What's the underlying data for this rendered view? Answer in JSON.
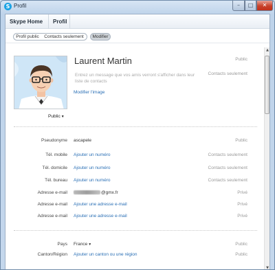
{
  "window": {
    "title": "Profil"
  },
  "tabs": [
    {
      "label": "Skype Home"
    },
    {
      "label": "Profil"
    }
  ],
  "subtabs": [
    {
      "label": "Profil public"
    },
    {
      "label": "Contacts seulement"
    },
    {
      "label": "Modifier"
    }
  ],
  "profile": {
    "name": "Laurent Martin",
    "name_visibility": "Public",
    "mood_placeholder": "Entrez un message que vos amis verront s'afficher dans leur liste de contacts",
    "mood_visibility": "Contacts seulement",
    "change_picture_label": "Modifier l'image",
    "picture_visibility": "Public"
  },
  "fields": [
    {
      "label": "Pseudonyme",
      "value": "ascapele",
      "visibility": "Public"
    },
    {
      "label": "Tél. mobile",
      "value": "Ajouter un numéro",
      "visibility": "Contacts seulement"
    },
    {
      "label": "Tél. domicile",
      "value": "Ajouter un numéro",
      "visibility": "Contacts seulement"
    },
    {
      "label": "Tél. bureau",
      "value": "Ajouter un numéro",
      "visibility": "Contacts seulement"
    },
    {
      "label": "Adresse e-mail",
      "value": "@gmx.fr",
      "visibility": "Privé"
    },
    {
      "label": "Adresse e-mail",
      "value": "Ajouter une adresse e-mail",
      "visibility": "Privé"
    },
    {
      "label": "Adresse e-mail",
      "value": "Ajouter une adresse e-mail",
      "visibility": "Privé"
    }
  ],
  "location": [
    {
      "label": "Pays",
      "value": "France",
      "visibility": "Public"
    },
    {
      "label": "Canton/Région",
      "value": "Ajouter un canton ou une région",
      "visibility": "Public"
    }
  ]
}
